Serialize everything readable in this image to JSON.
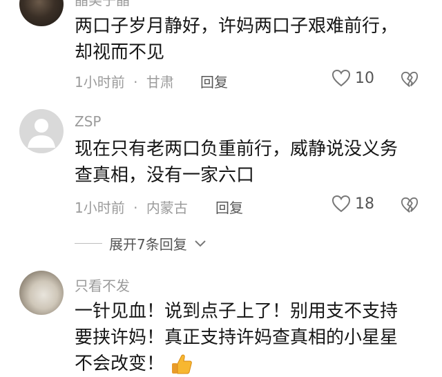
{
  "comments": [
    {
      "username": "晶美子晶",
      "text_line1": "两口子岁月静好，许妈两口子艰难前行，",
      "text_line2": "却视而不见",
      "time": "1小时前",
      "location": "甘肃",
      "reply_label": "回复",
      "likes": "10"
    },
    {
      "username": "ZSP",
      "text_line1": "现在只有老两口负重前行，威静说没义务",
      "text_line2": "查真相，没有一家六口",
      "time": "1小时前",
      "location": "内蒙古",
      "reply_label": "回复",
      "likes": "18",
      "expand_label": "展开7条回复"
    },
    {
      "username": "只看不发",
      "text_line1": "一针见血！说到点子上了！别用支不支持",
      "text_line2": "要挟许妈！真正支持许妈查真相的小星星",
      "text_line3": "不会改变！",
      "emoji": "thumbs-up"
    }
  ],
  "separator": "·"
}
